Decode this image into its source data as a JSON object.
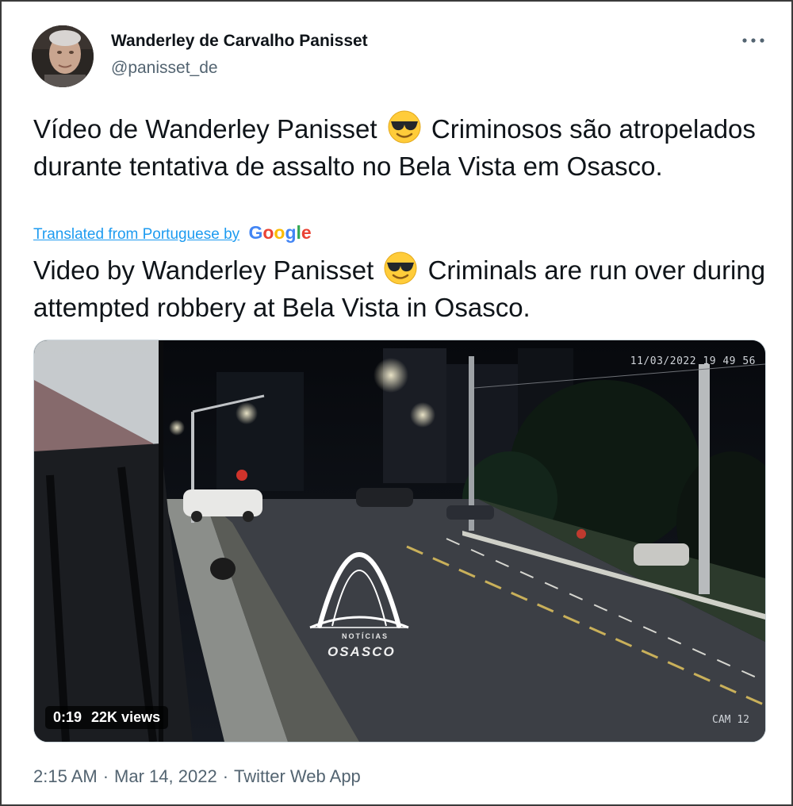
{
  "author": {
    "name": "Wanderley de Carvalho Panisset",
    "handle": "@panisset_de"
  },
  "menu_icon": "more-horizontal-icon",
  "tweet": {
    "original_before_emoji": "Vídeo de Wanderley Panisset",
    "original_after_emoji": "Criminosos são atropelados durante tentativa de assalto no Bela Vista em Osasco.",
    "translated_label": "Translated from Portuguese by",
    "translator_logo": "Google",
    "translation_before_emoji": "Video by Wanderley Panisset",
    "translation_after_emoji": "Criminals are run over during attempted robbery at Bela Vista in Osasco.",
    "emoji": "smiling-face-with-sunglasses-icon"
  },
  "video": {
    "cctv_timestamp": "11/03/2022 19 49 56",
    "camera_label": "CAM 12",
    "watermark_top": "NOTÍCIAS",
    "watermark_name": "OSASCO",
    "duration": "0:19",
    "views": "22K views"
  },
  "meta": {
    "time": "2:15 AM",
    "date": "Mar 14, 2022",
    "source": "Twitter Web App",
    "separator": "·"
  },
  "colors": {
    "text": "#0f1419",
    "secondary": "#536471",
    "link": "#1d9bf0"
  }
}
